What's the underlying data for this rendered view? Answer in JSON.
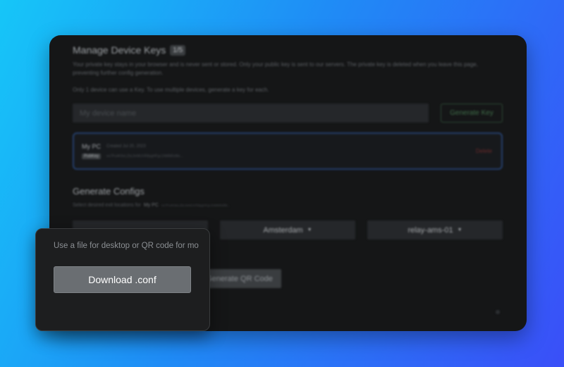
{
  "keys": {
    "title": "Manage Device Keys",
    "count_badge": "1/5",
    "privacy_note": "Your private key stays in your browser and is never sent or stored. Only your public key is sent to our servers. The private key is deleted when you leave this page, preventing further config generation.",
    "limit_note": "Only 1 device can use a Key. To use multiple devices, generate a key for each.",
    "device_name_placeholder": "My device name",
    "generate_key_label": "Generate Key"
  },
  "device": {
    "name": "My PC",
    "created": "Created Jul 20, 2023",
    "pubkey_tag": "PubKey",
    "pubkey_value": "nx7Pu4K9eLZbL0eMUVR8pgHFgc1NMM0sfkk...",
    "delete_label": "Delete"
  },
  "configs": {
    "title": "Generate Configs",
    "subtitle": "Select desired exit locations for",
    "device_ref": "My PC",
    "key_ref": "nx7Pu4K9eLZbL0eMUVR8pgHFgc1NMM0sfkk...",
    "select_1": "",
    "select_2": "Amsterdam",
    "select_3": "relay-ams-01",
    "qr_label": "Generate QR Code"
  },
  "popup": {
    "text": "Use a file for desktop or QR code for mo",
    "download_label": "Download .conf"
  },
  "colors": {
    "background_start": "#16c6f8",
    "background_end": "#3a4ff8",
    "panel": "#151617",
    "delete": "#6a2a2a",
    "accent_green": "#3f6e49"
  },
  "icons": {
    "caret": "caret-down-icon"
  }
}
